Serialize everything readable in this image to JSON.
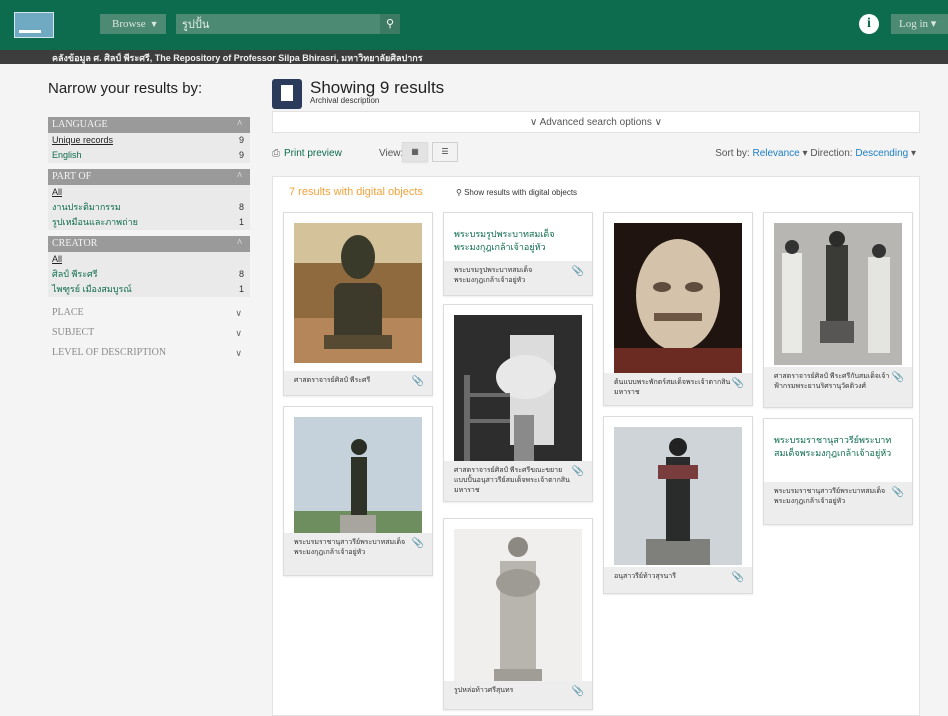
{
  "topbar": {
    "browse_label": "Browse",
    "search_value": "รูปปั้น",
    "login_label": "Log in"
  },
  "subtitle_bar": "คลังข้อมูล ศ. ศิลป์ พีระศรี, The Repository of Professor Silpa Bhirasri, มหาวิทยาลัยศิลปากร",
  "sidebar": {
    "title": "Narrow your results by:",
    "language": {
      "label": "LANGUAGE",
      "items": [
        {
          "label": "Unique records",
          "count": "9"
        },
        {
          "label": "English",
          "count": "9"
        }
      ]
    },
    "part_of": {
      "label": "PART OF",
      "items": [
        {
          "label": "All",
          "count": ""
        },
        {
          "label": "งานประติมากรรม",
          "count": "8"
        },
        {
          "label": "รูปเหมือนและภาพถ่าย",
          "count": "1"
        }
      ]
    },
    "creator": {
      "label": "CREATOR",
      "items": [
        {
          "label": "All",
          "count": ""
        },
        {
          "label": "ศิลป์ พีระศรี",
          "count": "8"
        },
        {
          "label": "ไพฑูรย์ เมืองสมบูรณ์",
          "count": "1"
        }
      ]
    },
    "collapsed": [
      "PLACE",
      "SUBJECT",
      "LEVEL OF DESCRIPTION"
    ]
  },
  "main": {
    "title": "Showing 9 results",
    "subtitle": "Archival description",
    "advanced": "Advanced search options",
    "print": "Print preview",
    "view_label": "View:",
    "sort_by": "Sort by:",
    "sort_value": "Relevance",
    "direction_label": "Direction:",
    "direction_value": "Descending",
    "digital": "7 results with digital objects",
    "digital_link": "Show results with digital objects"
  },
  "cards": [
    {
      "caption": "ศาสตราจารย์ศิลป์ พีระศรี"
    },
    {
      "title": "พระบรมรูปพระบาทสมเด็จพระมงกุฎเกล้าเจ้าอยู่หัว",
      "caption": "พระบรมรูปพระบาทสมเด็จพระมงกุฎเกล้าเจ้าอยู่หัว"
    },
    {
      "caption": "ต้นแบบพระพักตร์สมเด็จพระเจ้าตากสินมหาราช"
    },
    {
      "caption": "ศาสตราจารย์ศิลป์ พีระศรีกับสมเด็จเจ้าฟ้ากรมพระยานริศรานุวัดติวงศ์"
    },
    {
      "caption": "ศาสตราจารย์ศิลป์ พีระศรีขณะขยายแบบปั้นอนุสาวรีย์สมเด็จพระเจ้าตากสินมหาราช"
    },
    {
      "caption": "พระบรมราชานุสาวรีย์พระบาทสมเด็จพระมงกุฎเกล้าเจ้าอยู่หัว"
    },
    {
      "caption": "อนุสาวรีย์ท้าวสุรนารี"
    },
    {
      "title": "พระบรมราชานุสาวรีย์พระบาทสมเด็จพระมงกุฎเกล้าเจ้าอยู่หัว",
      "caption": "พระบรมราชานุสาวรีย์พระบาทสมเด็จพระมงกุฎเกล้าเจ้าอยู่หัว"
    },
    {
      "caption": "รูปหล่อท้าวศรีสุนทร"
    }
  ]
}
